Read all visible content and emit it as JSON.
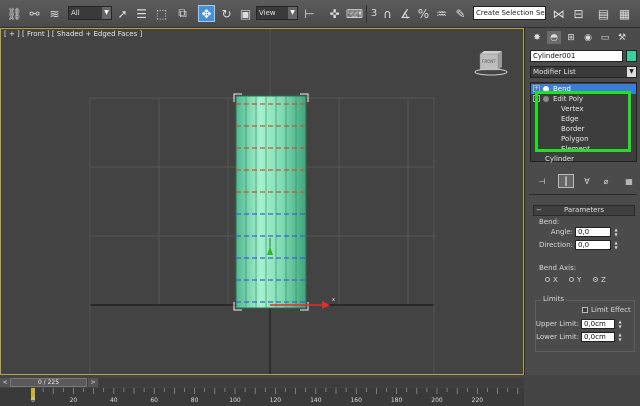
{
  "toolbar": {
    "selection_filter": "All",
    "ref_coord": "View",
    "snap_number": "3",
    "named_selection": "Create Selection Se",
    "icons": [
      "link-icon",
      "unlink-icon",
      "bind-spacewarp-icon",
      "select-object-icon",
      "select-by-name-icon",
      "rect-selection-icon",
      "window-crossing-icon",
      "move-icon",
      "rotate-icon",
      "scale-icon",
      "pivot-icon",
      "select-manipulate-icon",
      "keyboard-shortcut-icon",
      "snap-toggle-icon",
      "angle-snap-icon",
      "percent-snap-icon",
      "spinner-snap-icon",
      "edit-named-sets-icon",
      "mirror-icon",
      "align-icon",
      "layer-explorer-icon",
      "scene-explorer-icon"
    ]
  },
  "viewport": {
    "label": "[ + ] [ Front ] [ Shaded + Edged Faces ]",
    "viewcube_label": "FRONT",
    "axis_label": "x"
  },
  "panel": {
    "object_name": "Cylinder001",
    "object_color": "#38d39c",
    "modifier_list": "Modifier List",
    "stack": [
      {
        "label": "Bend",
        "selected": true
      },
      {
        "label": "Edit Poly",
        "selected": false
      },
      {
        "label": "Vertex",
        "selected": false
      },
      {
        "label": "Edge",
        "selected": false
      },
      {
        "label": "Border",
        "selected": false
      },
      {
        "label": "Polygon",
        "selected": false
      },
      {
        "label": "Element",
        "selected": false
      },
      {
        "label": "Cylinder",
        "selected": false
      }
    ],
    "parameters_title": "Parameters",
    "bend_group": "Bend:",
    "angle_label": "Angle:",
    "angle_value": "0,0",
    "direction_label": "Direction:",
    "direction_value": "0,0",
    "bend_axis_label": "Bend Axis:",
    "axes": [
      {
        "label": "X",
        "selected": false
      },
      {
        "label": "Y",
        "selected": false
      },
      {
        "label": "Z",
        "selected": true
      }
    ],
    "limits_label": "Limits",
    "limit_effect_label": "Limit Effect",
    "limit_effect_checked": false,
    "upper_limit_label": "Upper Limit:",
    "upper_limit_value": "0,0cm",
    "lower_limit_label": "Lower Limit:",
    "lower_limit_value": "0,0cm"
  },
  "timeline": {
    "frame_display": "0 / 225",
    "prev_label": "<",
    "next_label": ">",
    "ticks": [
      "0",
      "20",
      "40",
      "60",
      "80",
      "100",
      "120",
      "140",
      "160",
      "180",
      "200",
      "220"
    ]
  }
}
